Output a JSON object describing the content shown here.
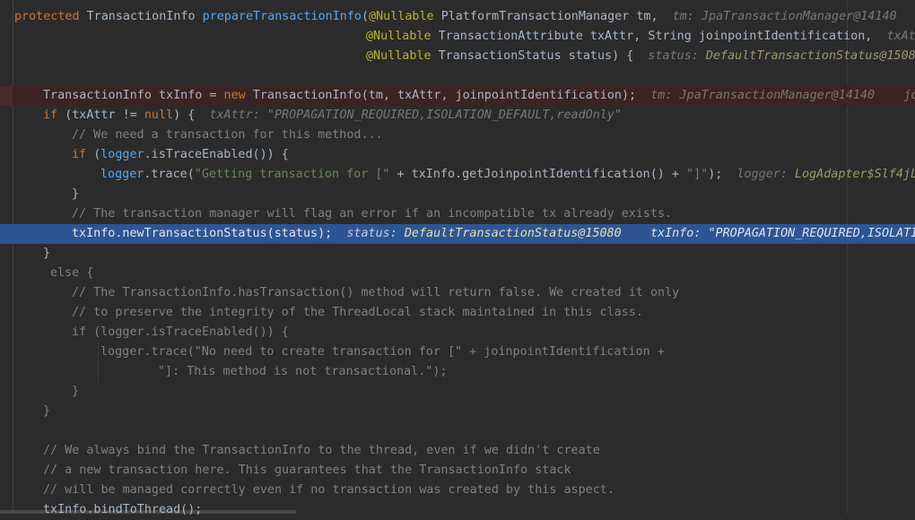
{
  "editor": {
    "lines": [
      {
        "segments": [
          {
            "t": "protected ",
            "c": "kw"
          },
          {
            "t": "TransactionInfo ",
            "c": "pl"
          },
          {
            "t": "prepareTransactionInfo",
            "c": "fn"
          },
          {
            "t": "(",
            "c": "pl"
          },
          {
            "t": "@Nullable ",
            "c": "ann"
          },
          {
            "t": "PlatformTransactionManager tm,  ",
            "c": "pl"
          },
          {
            "t": "tm: JpaTransactionManager@14140",
            "c": "dbg"
          }
        ],
        "indent": 16
      },
      {
        "segments": [
          {
            "t": "@Nullable ",
            "c": "ann"
          },
          {
            "t": "TransactionAttribute txAttr, String joinpointIdentification,  ",
            "c": "pl"
          },
          {
            "t": "txAt",
            "c": "dbg"
          }
        ],
        "indent": 408
      },
      {
        "segments": [
          {
            "t": "@Nullable ",
            "c": "ann"
          },
          {
            "t": "TransactionStatus status) {  ",
            "c": "pl"
          },
          {
            "t": "status: ",
            "c": "dbg"
          },
          {
            "t": "DefaultTransactionStatus@1508",
            "c": "dbgv"
          }
        ],
        "indent": 408
      },
      {
        "segments": [],
        "indent": 16
      },
      {
        "segments": [
          {
            "t": "TransactionInfo txInfo = ",
            "c": "pl"
          },
          {
            "t": "new ",
            "c": "kw"
          },
          {
            "t": "TransactionInfo(tm, txAttr, joinpointIdentification);  ",
            "c": "pl"
          },
          {
            "t": "tm: JpaTransactionManager@14140    joi",
            "c": "dbg"
          }
        ],
        "indent": 48,
        "kind": "bp"
      },
      {
        "segments": [
          {
            "t": "if ",
            "c": "kw"
          },
          {
            "t": "(txAttr != ",
            "c": "pl"
          },
          {
            "t": "null",
            "c": "kw"
          },
          {
            "t": ") {  ",
            "c": "pl"
          },
          {
            "t": "txAttr: \"PROPAGATION_REQUIRED,ISOLATION_DEFAULT,readOnly\"",
            "c": "dbg"
          }
        ],
        "indent": 48
      },
      {
        "segments": [
          {
            "t": "// We need a transaction for this method...",
            "c": "cm"
          }
        ],
        "indent": 80
      },
      {
        "segments": [
          {
            "t": "if ",
            "c": "kw"
          },
          {
            "t": "(",
            "c": "pl"
          },
          {
            "t": "logger",
            "c": "fn"
          },
          {
            "t": ".isTraceEnabled()) {",
            "c": "pl"
          }
        ],
        "indent": 80
      },
      {
        "segments": [
          {
            "t": "logger",
            "c": "fn"
          },
          {
            "t": ".trace(",
            "c": "pl"
          },
          {
            "t": "\"Getting transaction for [\"",
            "c": "str"
          },
          {
            "t": " + txInfo.getJoinpointIdentification() + ",
            "c": "pl"
          },
          {
            "t": "\"]\"",
            "c": "str"
          },
          {
            "t": ");  ",
            "c": "pl"
          },
          {
            "t": "logger: ",
            "c": "dbg"
          },
          {
            "t": "LogAdapter$Slf4jL",
            "c": "dbgv"
          }
        ],
        "indent": 112
      },
      {
        "segments": [
          {
            "t": "}",
            "c": "pl"
          }
        ],
        "indent": 80
      },
      {
        "segments": [
          {
            "t": "// The transaction manager will flag an error if an incompatible tx already exists.",
            "c": "cm"
          }
        ],
        "indent": 80
      },
      {
        "segments": [
          {
            "t": "txInfo.newTransactionStatus(status);  ",
            "c": "pl"
          },
          {
            "t": "status: ",
            "c": "dbg"
          },
          {
            "t": "DefaultTransactionStatus@15080",
            "c": "dbgv"
          },
          {
            "t": "    txInfo: \"PROPAGATION_REQUIRED,ISOLATI",
            "c": "dbgs"
          }
        ],
        "indent": 80,
        "kind": "exec"
      },
      {
        "segments": [
          {
            "t": "}",
            "c": "pl"
          }
        ],
        "indent": 48
      },
      {
        "segments": [
          {
            "t": "else {",
            "c": "cm"
          }
        ],
        "indent": 56
      },
      {
        "segments": [
          {
            "t": "// The TransactionInfo.hasTransaction() method will return false. We created it only",
            "c": "cm"
          }
        ],
        "indent": 80
      },
      {
        "segments": [
          {
            "t": "// to preserve the integrity of the ThreadLocal stack maintained in this class.",
            "c": "cm"
          }
        ],
        "indent": 80
      },
      {
        "segments": [
          {
            "t": "if (logger.isTraceEnabled()) {",
            "c": "cm"
          }
        ],
        "indent": 80
      },
      {
        "segments": [
          {
            "t": "logger.trace(\"No need to create transaction for [\" + joinpointIdentification +",
            "c": "cm"
          }
        ],
        "indent": 112
      },
      {
        "segments": [
          {
            "t": "\"]: This method is not transactional.\");",
            "c": "cm"
          }
        ],
        "indent": 176
      },
      {
        "segments": [
          {
            "t": "}",
            "c": "cm"
          }
        ],
        "indent": 80
      },
      {
        "segments": [
          {
            "t": "}",
            "c": "cm"
          }
        ],
        "indent": 48
      },
      {
        "segments": [],
        "indent": 16
      },
      {
        "segments": [
          {
            "t": "// We always bind the TransactionInfo to the thread, even if we didn't create",
            "c": "cm"
          }
        ],
        "indent": 48
      },
      {
        "segments": [
          {
            "t": "// a new transaction here. This guarantees that the TransactionInfo stack",
            "c": "cm"
          }
        ],
        "indent": 48
      },
      {
        "segments": [
          {
            "t": "// will be managed correctly even if no transaction was created by this aspect.",
            "c": "cm"
          }
        ],
        "indent": 48
      },
      {
        "segments": [
          {
            "t": "txInfo.bindToThread();",
            "c": "pl"
          }
        ],
        "indent": 48
      }
    ]
  }
}
